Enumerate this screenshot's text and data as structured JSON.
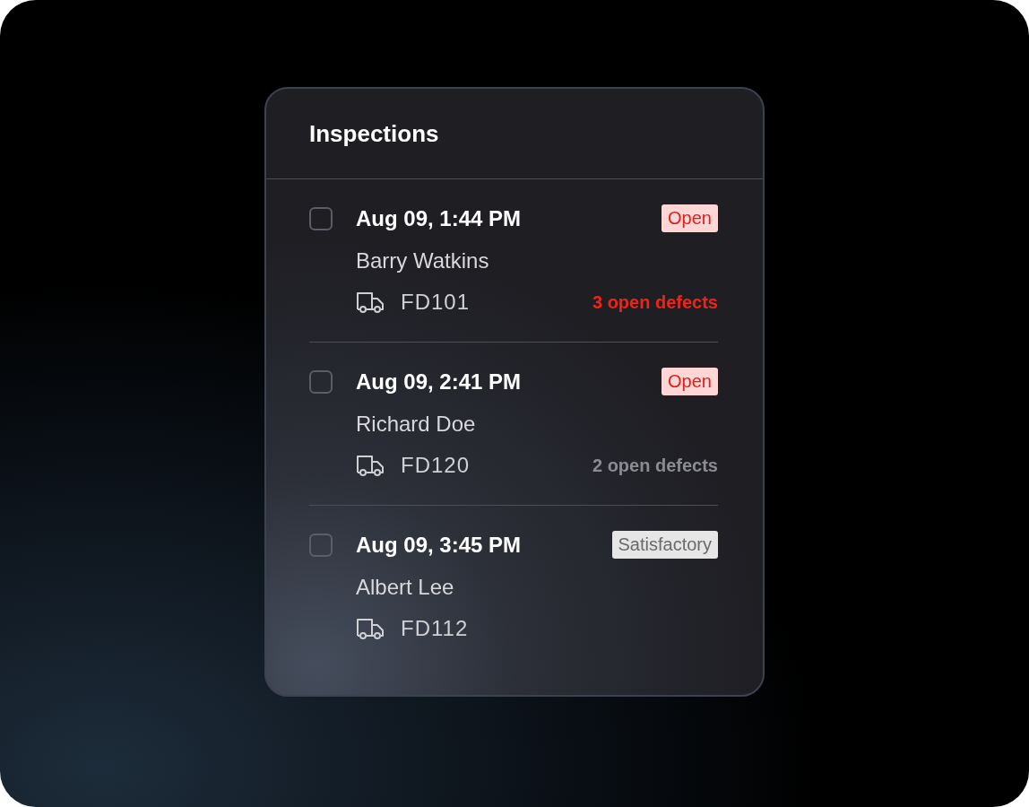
{
  "card": {
    "title": "Inspections"
  },
  "inspections": [
    {
      "checked": false,
      "datetime": "Aug 09, 1:44 PM",
      "status": {
        "kind": "open",
        "label": "Open"
      },
      "inspector": "Barry Watkins",
      "vehicle": "FD101",
      "defects": {
        "text": "3 open defects",
        "urgent": true
      }
    },
    {
      "checked": false,
      "datetime": "Aug 09, 2:41 PM",
      "status": {
        "kind": "open",
        "label": "Open"
      },
      "inspector": "Richard Doe",
      "vehicle": "FD120",
      "defects": {
        "text": "2 open defects",
        "urgent": false
      }
    },
    {
      "checked": false,
      "datetime": "Aug 09, 3:45 PM",
      "status": {
        "kind": "satisfactory",
        "label": "Satisfactory"
      },
      "inspector": "Albert Lee",
      "vehicle": "FD112"
    }
  ]
}
